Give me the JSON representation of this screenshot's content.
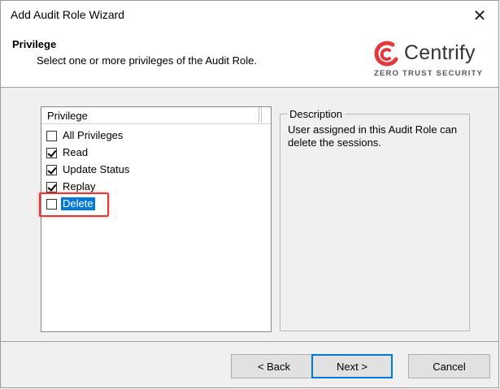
{
  "window": {
    "title": "Add Audit Role Wizard",
    "close_glyph": "✕"
  },
  "header": {
    "title": "Privilege",
    "subtitle": "Select one or more privileges of the Audit Role.",
    "logo": {
      "word": "Centrify",
      "tagline": "ZERO TRUST SECURITY",
      "mark_color": "#e0393e"
    }
  },
  "privileges": {
    "column_header": "Privilege",
    "items": [
      {
        "label": "All Privileges",
        "checked": false,
        "selected": false
      },
      {
        "label": "Read",
        "checked": true,
        "selected": false
      },
      {
        "label": "Update Status",
        "checked": true,
        "selected": false
      },
      {
        "label": "Replay",
        "checked": true,
        "selected": false
      },
      {
        "label": "Delete",
        "checked": false,
        "selected": true
      }
    ]
  },
  "description": {
    "legend": "Description",
    "text": "User assigned in this Audit Role can delete the sessions."
  },
  "buttons": {
    "back": "< Back",
    "next": "Next >",
    "cancel": "Cancel"
  },
  "colors": {
    "selection": "#0078d7",
    "annotation_highlight": "#e53935"
  }
}
